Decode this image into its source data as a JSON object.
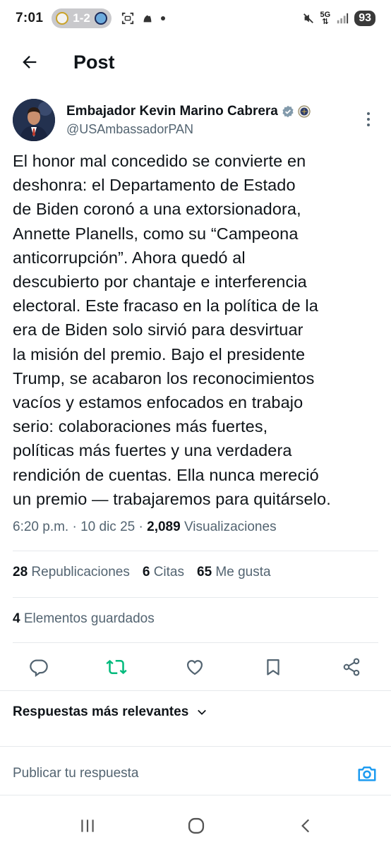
{
  "status_bar": {
    "time": "7:01",
    "match_score": "1-2",
    "network": "5G",
    "battery": "93"
  },
  "header": {
    "title": "Post"
  },
  "post": {
    "author_name": "Embajador Kevin Marino Cabrera",
    "handle": "@USAmbassadorPAN",
    "text_lines": [
      "El honor mal concedido se convierte en",
      "deshonra: el Departamento de Estado",
      "de Biden coronó a una extorsionadora,",
      "Annette Planells, como su “Campeona",
      "anticorrupción”. Ahora quedó al",
      "descubierto por chantaje e interferencia",
      "electoral. Este fracaso en la política de la",
      "era de Biden solo sirvió para desvirtuar",
      "la misión del premio. Bajo el presidente",
      "Trump, se acabaron los reconocimientos",
      "vacíos y estamos enfocados en trabajo",
      "serio: colaboraciones más fuertes,",
      "políticas más fuertes y una verdadera",
      "rendición de cuentas. Ella nunca mereció",
      "un premio — trabajaremos para quitárselo."
    ],
    "time": "6:20 p.m.",
    "date": "10 dic 25",
    "views_count": "2,089",
    "views_label": "Visualizaciones"
  },
  "stats": {
    "reposts_count": "28",
    "reposts_label": "Republicaciones",
    "quotes_count": "6",
    "quotes_label": "Citas",
    "likes_count": "65",
    "likes_label": "Me gusta",
    "bookmarks_count": "4",
    "bookmarks_label": "Elementos guardados"
  },
  "replies": {
    "sort_label": "Respuestas más relevantes",
    "reply_placeholder": "Publicar tu respuesta"
  },
  "colors": {
    "text": "#0f1419",
    "secondary": "#536471",
    "verified": "#829aab",
    "repost_active": "#00ba7c",
    "accent_blue": "#1d9bf0"
  }
}
